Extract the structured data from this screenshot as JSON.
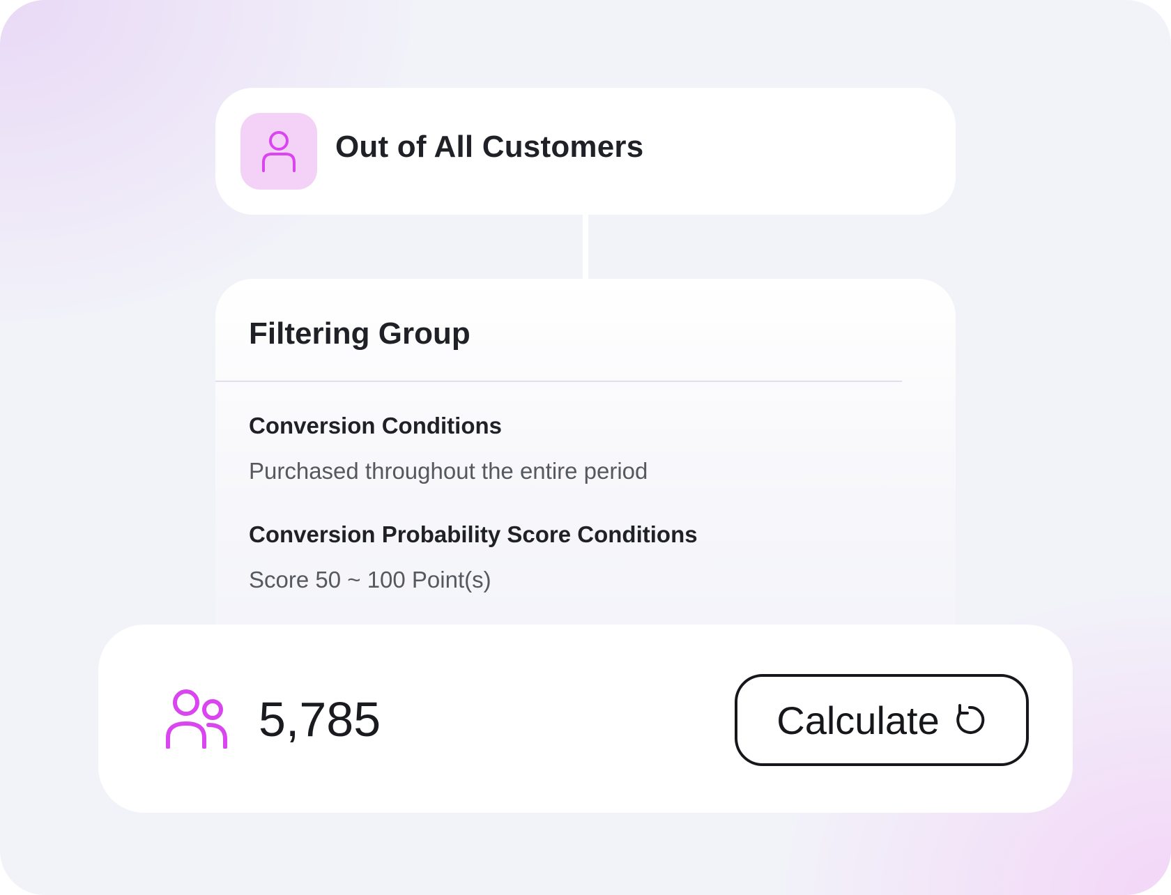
{
  "source_card": {
    "title": "Out of All Customers",
    "icon": "user-icon"
  },
  "filter_group": {
    "title": "Filtering Group",
    "conditions": [
      {
        "label": "Conversion Conditions",
        "value": "Purchased throughout the entire period"
      },
      {
        "label": "Conversion Probability Score Conditions",
        "value": "Score 50 ~ 100 Point(s)"
      }
    ]
  },
  "result": {
    "icon": "users-icon",
    "count": "5,785",
    "button_label": "Calculate",
    "button_icon": "refresh-icon"
  },
  "colors": {
    "accent": "#d946ef",
    "accent_bg": "#f4d2f7",
    "text_primary": "#1f2126",
    "text_secondary": "#55585f"
  }
}
